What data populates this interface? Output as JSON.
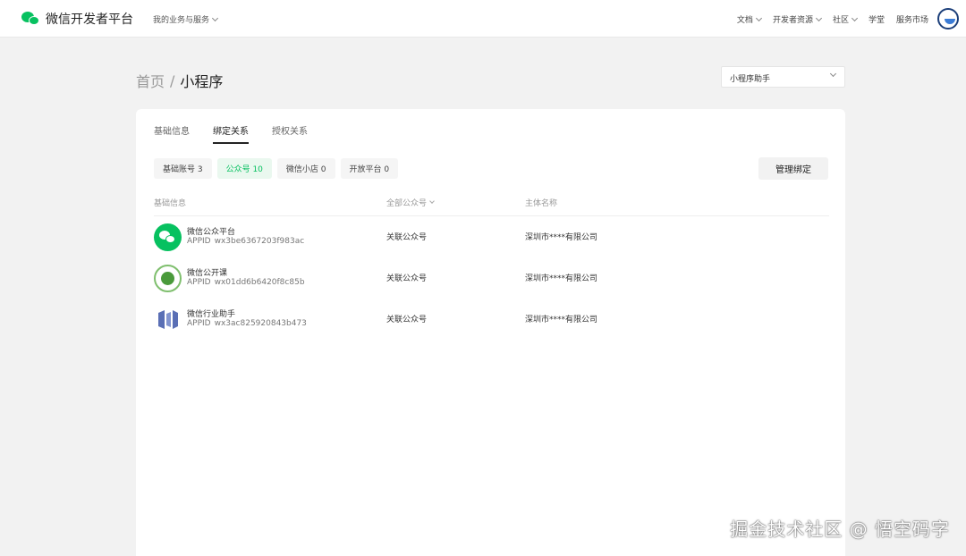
{
  "header": {
    "brand": "微信开发者平台",
    "biz_menu": "我的业务与服务",
    "nav": [
      "文档",
      "开发者资源",
      "社区",
      "学堂",
      "服务市场"
    ]
  },
  "breadcrumb": {
    "home": "首页",
    "sep": "/",
    "current": "小程序"
  },
  "app_select": {
    "value": "小程序助手"
  },
  "tabs": [
    "基础信息",
    "绑定关系",
    "授权关系"
  ],
  "active_tab": 1,
  "chips": [
    {
      "label": "基础账号 3"
    },
    {
      "label": "公众号 10"
    },
    {
      "label": "微信小店 0"
    },
    {
      "label": "开放平台 0"
    }
  ],
  "manage_label": "管理绑定",
  "table": {
    "headers": [
      "基础信息",
      "全部公众号",
      "主体名称"
    ],
    "rows": [
      {
        "name": "微信公众平台",
        "appid_label": "APPID",
        "appid": "wx3be6367203f983ac",
        "type": "关联公众号",
        "owner": "深圳市****有限公司",
        "icon": "wechat-logo-icon"
      },
      {
        "name": "微信公开课",
        "appid_label": "APPID",
        "appid": "wx01dd6b6420f8c85b",
        "type": "关联公众号",
        "owner": "深圳市****有限公司",
        "icon": "open-class-logo-icon"
      },
      {
        "name": "微信行业助手",
        "appid_label": "APPID",
        "appid": "wx3ac825920843b473",
        "type": "关联公众号",
        "owner": "深圳市****有限公司",
        "icon": "industry-assistant-logo-icon"
      }
    ]
  },
  "watermark": "掘金技术社区 @ 悟空码字",
  "colors": {
    "accent": "#07c160",
    "page_bg": "#f2f2f2"
  }
}
